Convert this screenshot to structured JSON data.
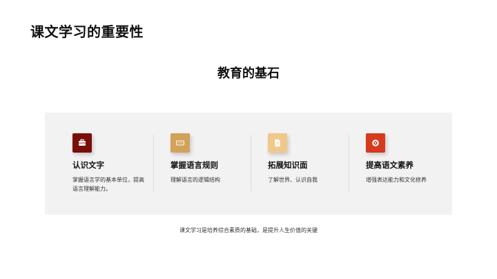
{
  "page": {
    "title": "课文学习的重要性",
    "section_title": "教育的基石",
    "footer": "课文学习是培养综合素质的基础，是提升人生价值的关键"
  },
  "cards": [
    {
      "title": "认识文字",
      "desc": "掌握语言学的基本单位，提高语言理解能力。",
      "icon": "briefcase-icon",
      "color": "#7a0f0a"
    },
    {
      "title": "掌握语言规则",
      "desc": "理解语言的逻辑结构",
      "icon": "keyboard-icon",
      "color": "#d2a15a"
    },
    {
      "title": "拓展知识面",
      "desc": "了解世界、认识自我",
      "icon": "document-icon",
      "color": "#efc98b"
    },
    {
      "title": "提高语文素养",
      "desc": "增强表达能力和文化修养",
      "icon": "target-icon",
      "color": "#d63a1e"
    }
  ]
}
